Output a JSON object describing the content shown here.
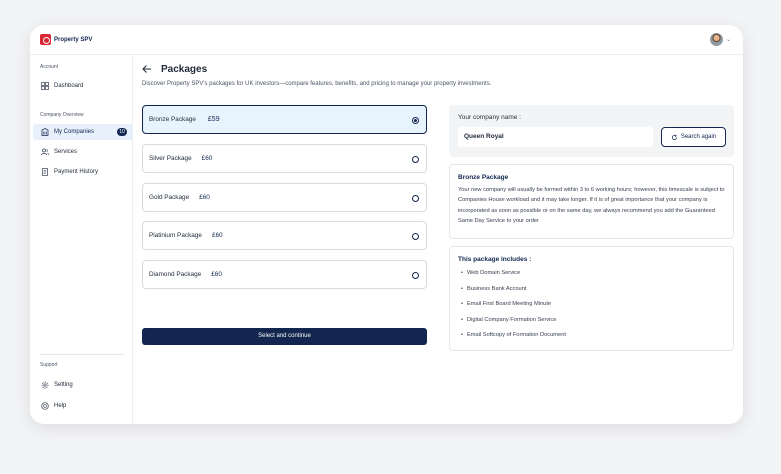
{
  "header": {
    "logo_text": "Property SPV",
    "avatar_icon": "user-avatar",
    "chevron_icon": "chevron-down-icon"
  },
  "sidebar": {
    "account_section": "Account",
    "dashboard": "Dashboard",
    "company_section": "Company Overview",
    "my_companies": "My Companies",
    "my_companies_badge": "10",
    "services": "Services",
    "payment_history": "Payment History",
    "support_section": "Support",
    "setting": "Setting",
    "help": "Help"
  },
  "main": {
    "title": "Packages",
    "subtitle": "Discover Property SPV's packages for UK investors—compare features, benefits, and pricing to manage your property investments.",
    "packages": [
      {
        "name": "Bronze Package",
        "price": "£59",
        "selected": true
      },
      {
        "name": "Silver Package",
        "price": "£60",
        "selected": false
      },
      {
        "name": "Gold Package",
        "price": "£60",
        "selected": false
      },
      {
        "name": "Platinium Package",
        "price": "£60",
        "selected": false
      },
      {
        "name": "Diamond Package",
        "price": "£60",
        "selected": false
      }
    ],
    "cta_label": "Select and continue"
  },
  "company": {
    "label": "Your company name :",
    "value": "Queen Royal",
    "search_again_label": "Search again"
  },
  "description": {
    "title": "Bronze Package",
    "text": "Your new company will usually be formed within 3 to 6 working hours; however, this timescale is subject to Companies House workload and it may take longer. If it is of great importance that your company is incorporated as soon as possible or on the same day, we always recommend you add the Guaranteed Same Day Service to your order"
  },
  "includes": {
    "title": "This package includes :",
    "items": [
      "Web Domain Service",
      "Business Bank Account",
      "Email First Board Meeting Minute",
      "Digital Company Formation Service",
      "Email Softcopy of Formation Document"
    ]
  },
  "colors": {
    "primary": "#12264f",
    "accent_red": "#d92632",
    "selected_bg": "#e8f4fd"
  }
}
